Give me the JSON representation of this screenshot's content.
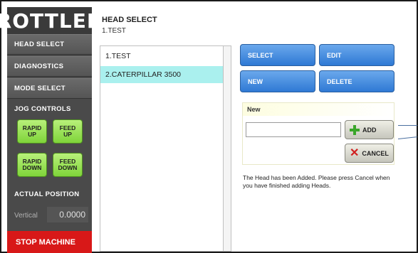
{
  "brand": {
    "logo_text": "ROTTLER"
  },
  "sidebar": {
    "nav": [
      {
        "label": "HEAD SELECT"
      },
      {
        "label": "DIAGNOSTICS"
      },
      {
        "label": "MODE SELECT"
      }
    ],
    "jog_header": "JOG CONTROLS",
    "jog": [
      {
        "line1": "RAPID",
        "line2": "UP"
      },
      {
        "line1": "FEED",
        "line2": "UP"
      },
      {
        "line1": "RAPID",
        "line2": "DOWN"
      },
      {
        "line1": "FEED",
        "line2": "DOWN"
      }
    ],
    "position_header": "ACTUAL POSITION",
    "vertical_label": "Vertical",
    "vertical_value": "0.0000",
    "stop_label": "STOP MACHINE"
  },
  "header": {
    "title": "HEAD SELECT",
    "subtitle": "1.TEST"
  },
  "head_list": {
    "items": [
      {
        "label": "1.TEST",
        "selected": false
      },
      {
        "label": "2.CATERPILLAR 3500",
        "selected": true
      }
    ]
  },
  "actions": {
    "select": "SELECT",
    "edit": "EDIT",
    "new": "NEW",
    "delete": "DELETE"
  },
  "new_panel": {
    "title": "New",
    "input_value": "",
    "add_label": "ADD",
    "cancel_label": "CANCEL"
  },
  "message": "The Head has been Added. Please press Cancel when you have finished adding Heads.",
  "colors": {
    "jog_green": "#7fd43a",
    "action_blue": "#2f79d4",
    "stop_red": "#d81818",
    "selected_row": "#aaf0ee"
  }
}
